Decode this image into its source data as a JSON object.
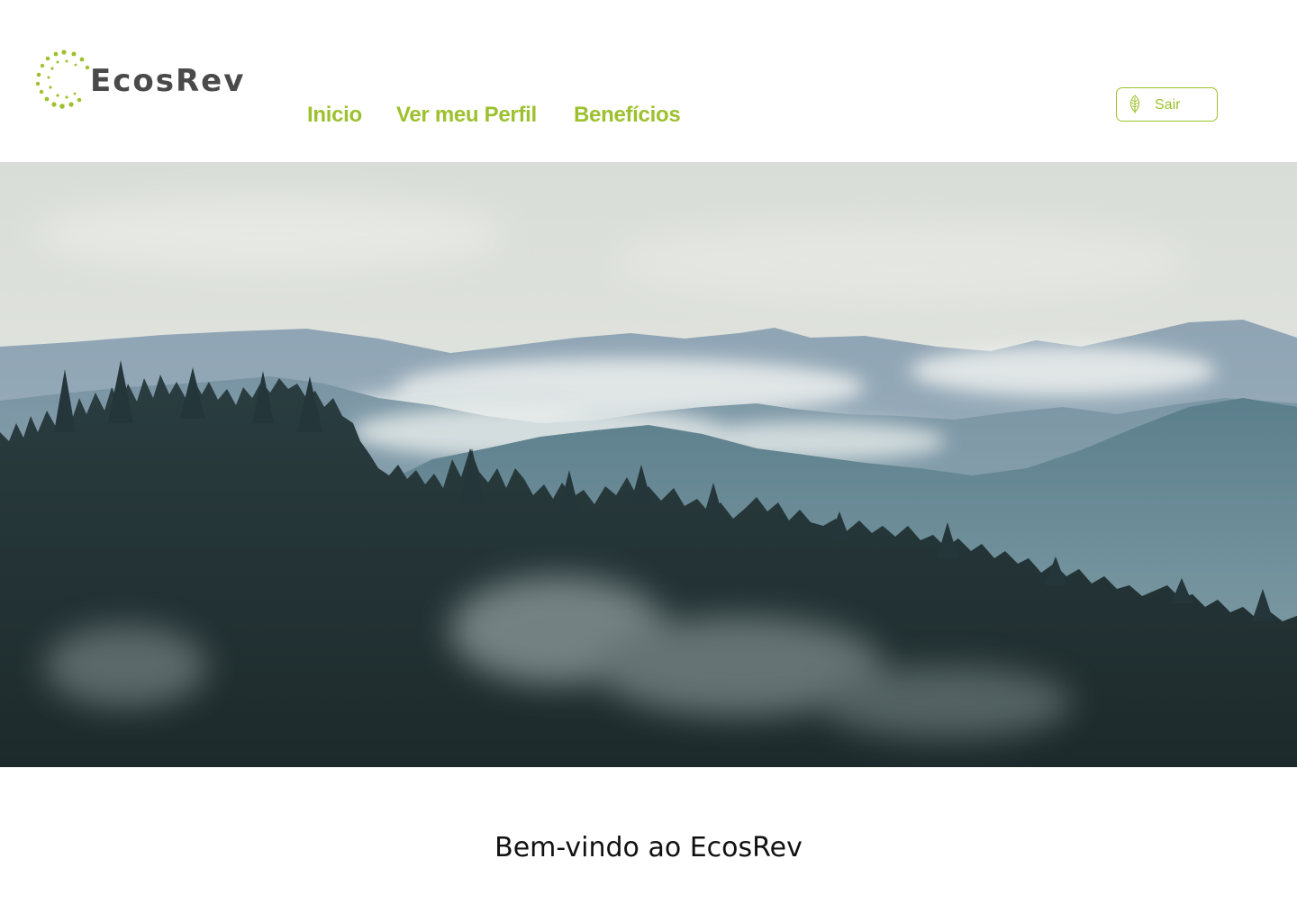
{
  "brand": {
    "name": "EcosRev",
    "accent_color": "#9dc12e",
    "logo_icon": "dotted-circle-logo-icon"
  },
  "nav": {
    "items": [
      {
        "label": "Inicio"
      },
      {
        "label": "Ver meu Perfil"
      },
      {
        "label": "Benefícios"
      }
    ]
  },
  "header": {
    "logout_label": "Sair",
    "logout_icon": "leaf-icon"
  },
  "hero": {
    "image": "misty-forest-mountains-photo"
  },
  "main": {
    "welcome_text": "Bem-vindo ao EcosRev"
  }
}
